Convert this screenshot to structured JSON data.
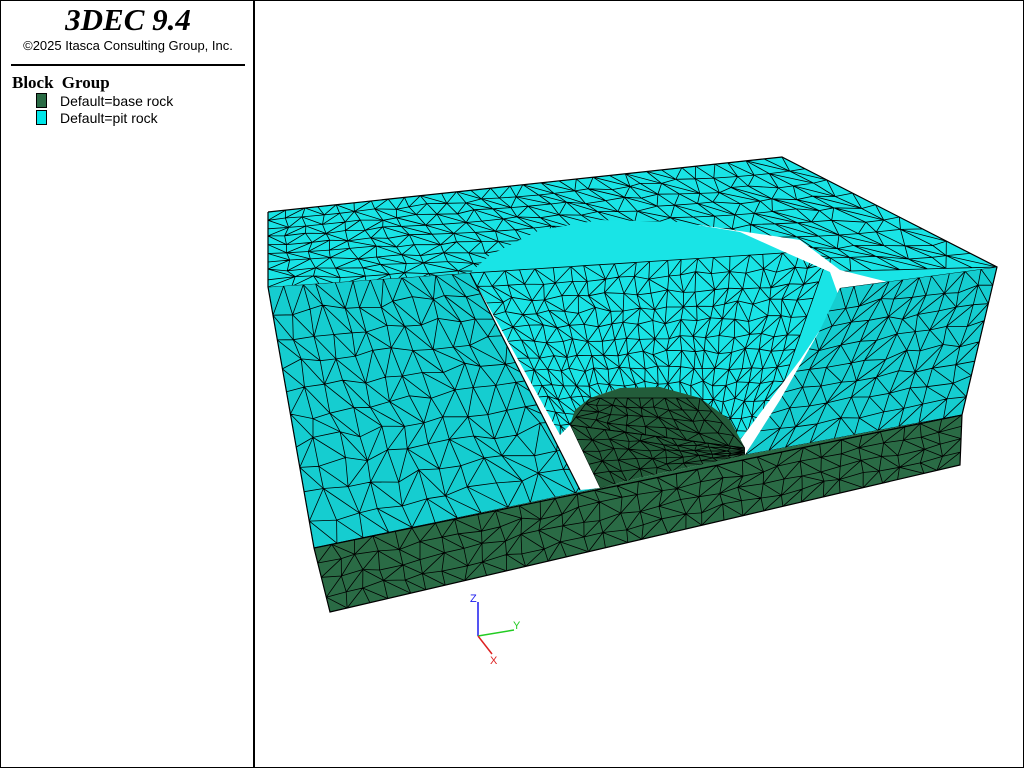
{
  "app": {
    "title": "3DEC 9.4",
    "copyright": "©2025 Itasca Consulting Group, Inc."
  },
  "legend": {
    "heading": "Block  Group",
    "items": [
      {
        "label": "Default=base rock",
        "color": "#2a6b45"
      },
      {
        "label": "Default=pit rock",
        "color": "#00e5e8"
      }
    ]
  },
  "axes": {
    "z": {
      "label": "Z",
      "color": "#1a1aee"
    },
    "y": {
      "label": "Y",
      "color": "#22cc22"
    },
    "x": {
      "label": "X",
      "color": "#dd2222"
    }
  },
  "colors": {
    "pit_rock_light": "#19e4e6",
    "pit_rock_mid": "#15cdd0",
    "pit_rock_dark": "#12b9bc",
    "base_rock": "#2a6b45",
    "base_rock_dark": "#235c3a",
    "mesh_line": "#000000"
  }
}
